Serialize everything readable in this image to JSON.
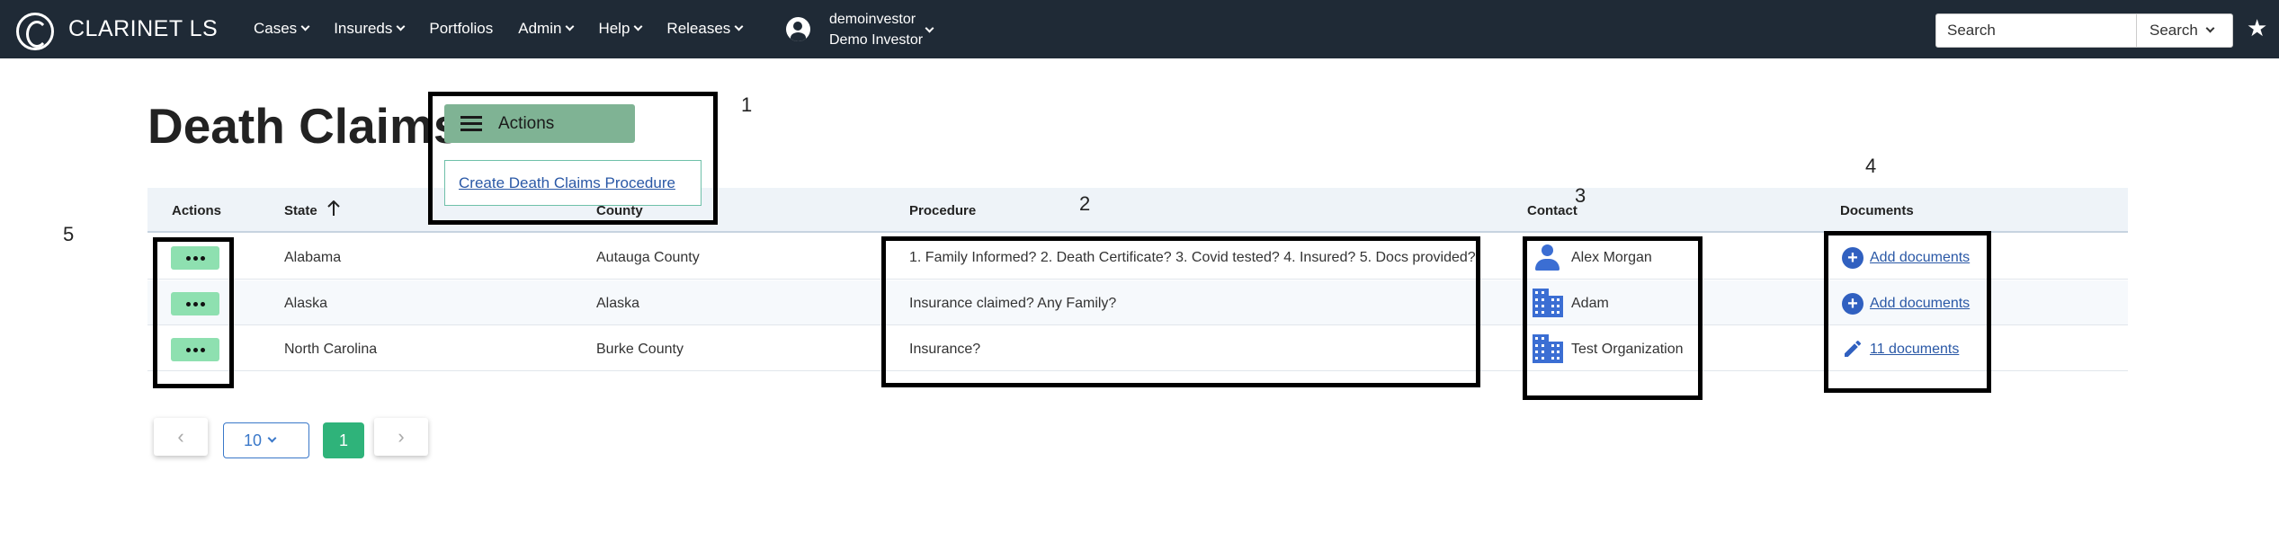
{
  "app": {
    "brand": "CLARINET LS",
    "logo_icon": "clarinet-logo-icon"
  },
  "nav": {
    "items": [
      {
        "label": "Cases",
        "dropdown": true
      },
      {
        "label": "Insureds",
        "dropdown": true
      },
      {
        "label": "Portfolios",
        "dropdown": false
      },
      {
        "label": "Admin",
        "dropdown": true
      },
      {
        "label": "Help",
        "dropdown": true
      },
      {
        "label": "Releases",
        "dropdown": true
      }
    ],
    "user": {
      "username": "demoinvestor",
      "display_name": "Demo Investor",
      "icon": "account-circle-icon"
    },
    "search": {
      "placeholder": "Search",
      "button_label": "Search"
    },
    "favorite_icon": "star-icon"
  },
  "page": {
    "title": "Death Claims",
    "actions_label": "Actions",
    "create_link": "Create Death Claims Procedure"
  },
  "annotations": [
    "1",
    "2",
    "3",
    "4",
    "5"
  ],
  "table": {
    "headers": {
      "actions": "Actions",
      "state": "State",
      "county": "County",
      "procedure": "Procedure",
      "contact": "Contact",
      "documents": "Documents"
    },
    "sort": {
      "column": "State",
      "direction": "ascending",
      "icon": "arrow-up-icon"
    },
    "rows": [
      {
        "state": "Alabama",
        "county": "Autauga County",
        "procedure": "1. Family Informed? 2. Death Certificate? 3. Covid tested? 4. Insured? 5. Docs provided?",
        "contact": "Alex Morgan",
        "contact_icon": "person-icon",
        "documents": "Add documents",
        "documents_icon": "add-circle-icon"
      },
      {
        "state": "Alaska",
        "county": "Alaska",
        "procedure": "Insurance claimed? Any Family?",
        "contact": "Adam",
        "contact_icon": "building-icon",
        "documents": "Add documents",
        "documents_icon": "add-circle-icon"
      },
      {
        "state": "North Carolina",
        "county": "Burke County",
        "procedure": "Insurance?",
        "contact": "Test Organization",
        "contact_icon": "building-icon",
        "documents": "11 documents",
        "documents_icon": "pencil-icon"
      }
    ]
  },
  "pagination": {
    "page_size": "10",
    "current_page": "1",
    "prev_icon": "chevron-left-icon",
    "next_icon": "chevron-right-icon"
  },
  "colors": {
    "nav_bg": "#1f2a36",
    "actions_button": "#7fb394",
    "row_action_button": "#8ee0b0",
    "link": "#2a58a6",
    "icon_blue": "#3b6ed3",
    "page_active": "#2fb37a",
    "header_bg": "#eef3f8"
  }
}
